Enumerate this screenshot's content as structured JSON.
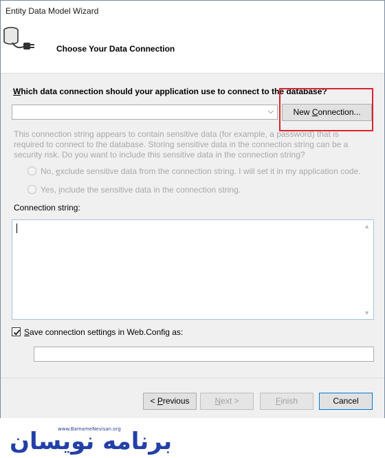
{
  "window": {
    "title": "Entity Data Model Wizard"
  },
  "header": {
    "heading": "Choose Your Data Connection",
    "icon": "database-plug-icon"
  },
  "connection": {
    "question_pre": "",
    "question_accel": "W",
    "question_post": "hich data connection should your application use to connect to the database?",
    "selected_value": "",
    "new_connection_pre": "New ",
    "new_connection_accel": "C",
    "new_connection_post": "onnection..."
  },
  "sensitive": {
    "info": "This connection string appears to contain sensitive data (for example, a password) that is required to connect to the database. Storing sensitive data in the connection string can be a security risk. Do you want to include this sensitive data in the connection string?",
    "option_no_pre": "No, ",
    "option_no_accel": "e",
    "option_no_post": "xclude sensitive data from the connection string. I will set it in my application code.",
    "option_yes_pre": "Yes, ",
    "option_yes_accel": "i",
    "option_yes_post": "nclude the sensitive data in the connection string."
  },
  "connection_string": {
    "label": "Connection string:",
    "value": ""
  },
  "save_settings": {
    "checked": true,
    "label_accel": "S",
    "label_post": "ave connection settings in Web.Config as:",
    "value": ""
  },
  "footer": {
    "previous_pre": "< ",
    "previous_accel": "P",
    "previous_post": "revious",
    "next_accel": "N",
    "next_post": "ext >",
    "finish_accel": "F",
    "finish_post": "inish",
    "cancel": "Cancel"
  },
  "watermark": {
    "url": "www.BamameNevisan.org",
    "text": "برنامه نویسان"
  },
  "colors": {
    "highlight": "#d9232e",
    "accent": "#0078d7",
    "watermark": "#2340a8"
  }
}
